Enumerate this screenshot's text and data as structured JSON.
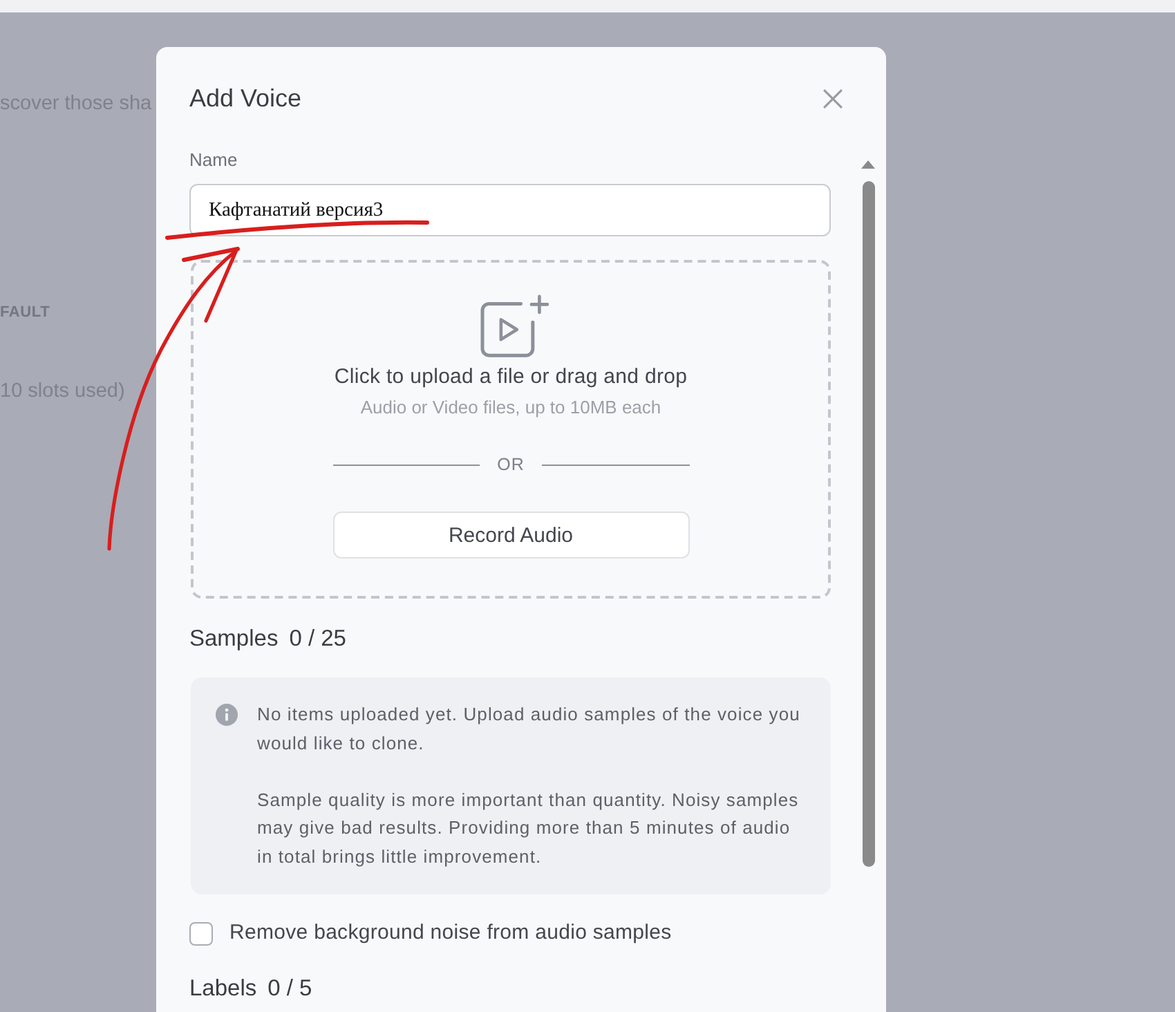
{
  "background_page": {
    "texts": [
      {
        "kind": "intro",
        "text": "scover those sha"
      },
      {
        "kind": "caption",
        "text": "FAULT"
      },
      {
        "kind": "note",
        "text": "10 slots used)"
      }
    ]
  },
  "dialog": {
    "title": "Add Voice",
    "name_field": {
      "label": "Name",
      "value": "Кафтанатий версия3"
    },
    "upload": {
      "title": "Click to upload a file or drag and drop",
      "hint": "Audio or Video files, up to 10MB each",
      "divider": "OR",
      "record_button": "Record Audio"
    },
    "samples": {
      "label": "Samples",
      "count": "0 / 25"
    },
    "info": {
      "paragraphs": [
        "No items uploaded yet. Upload audio samples of the voice you would like to clone.",
        "Sample quality is more important than quantity. Noisy samples may give bad results. Providing more than 5 minutes of audio in total brings little improvement."
      ]
    },
    "noise_checkbox": {
      "label": "Remove background noise from audio samples",
      "checked": false
    },
    "labels": {
      "label": "Labels",
      "count": "0 / 5"
    }
  },
  "annotations": {
    "name_underline": true,
    "arrow": true
  }
}
